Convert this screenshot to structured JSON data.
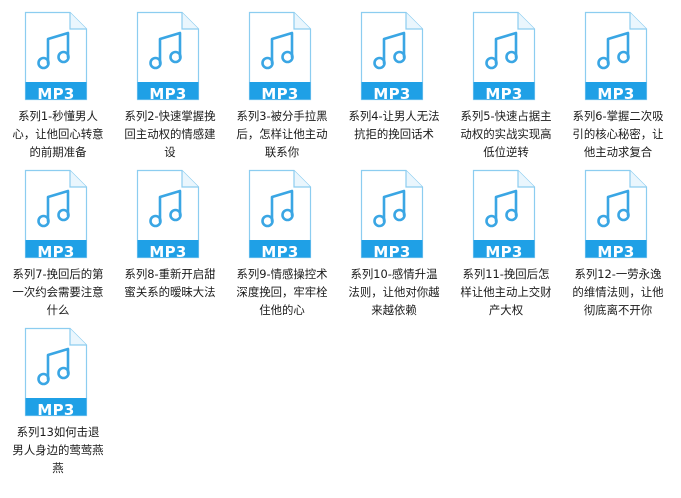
{
  "colors": {
    "background": "#ffffff",
    "icon_blue": "#1fa0e6",
    "icon_border": "#8ccdf0",
    "note_color": "#3aa6e4",
    "text": "#1b1b1b"
  },
  "file_icon": "music-note-icon",
  "files": [
    {
      "type_label": "MP3",
      "name": "系列1-秒懂男人心，让他回心转意的前期准备"
    },
    {
      "type_label": "MP3",
      "name": "系列2-快速掌握挽回主动权的情感建设"
    },
    {
      "type_label": "MP3",
      "name": "系列3-被分手拉黑后，怎样让他主动联系你"
    },
    {
      "type_label": "MP3",
      "name": "系列4-让男人无法抗拒的挽回话术"
    },
    {
      "type_label": "MP3",
      "name": "系列5-快速占据主动权的实战实现高低位逆转"
    },
    {
      "type_label": "MP3",
      "name": "系列6-掌握二次吸引的核心秘密，让他主动求复合"
    },
    {
      "type_label": "MP3",
      "name": "系列7-挽回后的第一次约会需要注意什么"
    },
    {
      "type_label": "MP3",
      "name": "系列8-重新开启甜蜜关系的暧昧大法"
    },
    {
      "type_label": "MP3",
      "name": "系列9-情感操控术深度挽回，牢牢栓住他的心"
    },
    {
      "type_label": "MP3",
      "name": "系列10-感情升温法则，让他对你越来越依赖"
    },
    {
      "type_label": "MP3",
      "name": "系列11-挽回后怎样让他主动上交财产大权"
    },
    {
      "type_label": "MP3",
      "name": "系列12-一劳永逸的维情法则，让他彻底离不开你"
    },
    {
      "type_label": "MP3",
      "name": "系列13如何击退男人身边的莺莺燕燕"
    }
  ]
}
